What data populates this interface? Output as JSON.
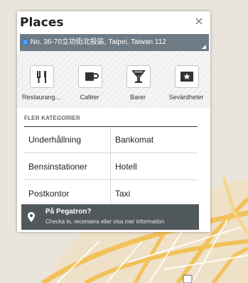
{
  "dialog": {
    "title": "Places",
    "close_symbol": "×",
    "location": "No. 36-70立功街北投區, Taipei, Taiwan 112"
  },
  "categories": [
    {
      "label": "Restaurang...",
      "icon": "fork-knife-icon"
    },
    {
      "label": "Caféer",
      "icon": "coffee-cup-icon"
    },
    {
      "label": "Barer",
      "icon": "cocktail-glass-icon"
    },
    {
      "label": "Sevärdheter",
      "icon": "ticket-star-icon"
    }
  ],
  "more": {
    "header": "FLER KATEGORIER",
    "items": [
      "Underhållning",
      "Bankomat",
      "Bensinstationer",
      "Hotell",
      "Postkontor",
      "Taxi"
    ]
  },
  "checkin": {
    "title": "På Pegatron?",
    "subtitle": "Checka in, recensera eller visa mer information"
  },
  "colors": {
    "location_bar": "#6f7b84",
    "toast": "#51585c",
    "map_road": "#f2c15a"
  }
}
